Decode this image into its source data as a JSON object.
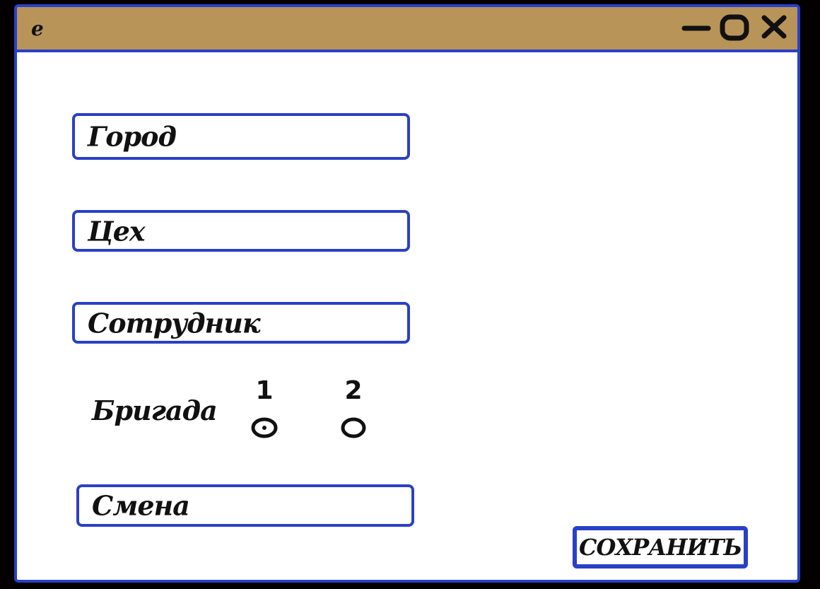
{
  "window": {
    "title": "e",
    "controls": [
      {
        "name": "minimize",
        "icon": "minimize-icon"
      },
      {
        "name": "maximize",
        "icon": "maximize-icon"
      },
      {
        "name": "close",
        "icon": "close-icon"
      }
    ]
  },
  "form": {
    "city_placeholder": "Город",
    "workshop_placeholder": "Цех",
    "employee_placeholder": "Сотрудник",
    "brigade_label": "Бригада",
    "brigade_options": [
      {
        "label": "1",
        "selected": true
      },
      {
        "label": "2",
        "selected": false
      }
    ],
    "shift_placeholder": "Смена",
    "save_label": "СОХРАНИТЬ"
  },
  "colors": {
    "accent": "#2a40c8",
    "titlebar": "#b99459",
    "background": "#050000",
    "window": "#ffffff"
  }
}
